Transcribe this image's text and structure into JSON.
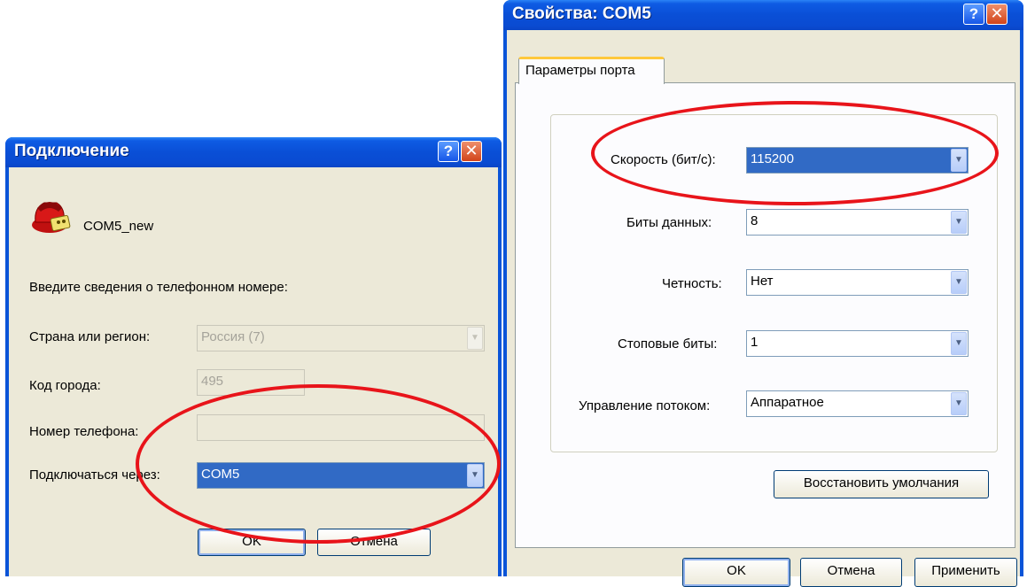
{
  "connect_dialog": {
    "title": "Подключение",
    "help_glyph": "?",
    "close_glyph": "✕",
    "connection_icon": "phone-connection-icon",
    "connection_name": "COM5_new",
    "prompt": "Введите сведения о телефонном номере:",
    "country_label": "Страна или регион:",
    "country_value": "Россия (7)",
    "area_code_label": "Код города:",
    "area_code_value": "495",
    "phone_label": "Номер телефона:",
    "phone_value": "",
    "connect_via_label": "Подключаться через:",
    "connect_via_value": "COM5",
    "ok_label": "OK",
    "cancel_label": "Отмена"
  },
  "properties_dialog": {
    "title": "Свойства: COM5",
    "help_glyph": "?",
    "close_glyph": "✕",
    "tab_label": "Параметры порта",
    "fields": [
      {
        "label": "Скорость (бит/с):",
        "value": "115200"
      },
      {
        "label": "Биты данных:",
        "value": "8"
      },
      {
        "label": "Четность:",
        "value": "Нет"
      },
      {
        "label": "Стоповые биты:",
        "value": "1"
      },
      {
        "label": "Управление потоком:",
        "value": "Аппаратное"
      }
    ],
    "restore_defaults_label": "Восстановить умолчания",
    "ok_label": "OK",
    "cancel_label": "Отмена",
    "apply_label": "Применить"
  },
  "colors": {
    "titlebar": "#0a4fd6",
    "dialog_bg": "#ece9d8",
    "selection": "#316ac5",
    "annotation_ellipse": "#e8141a"
  },
  "dropdown_glyph": "▼"
}
